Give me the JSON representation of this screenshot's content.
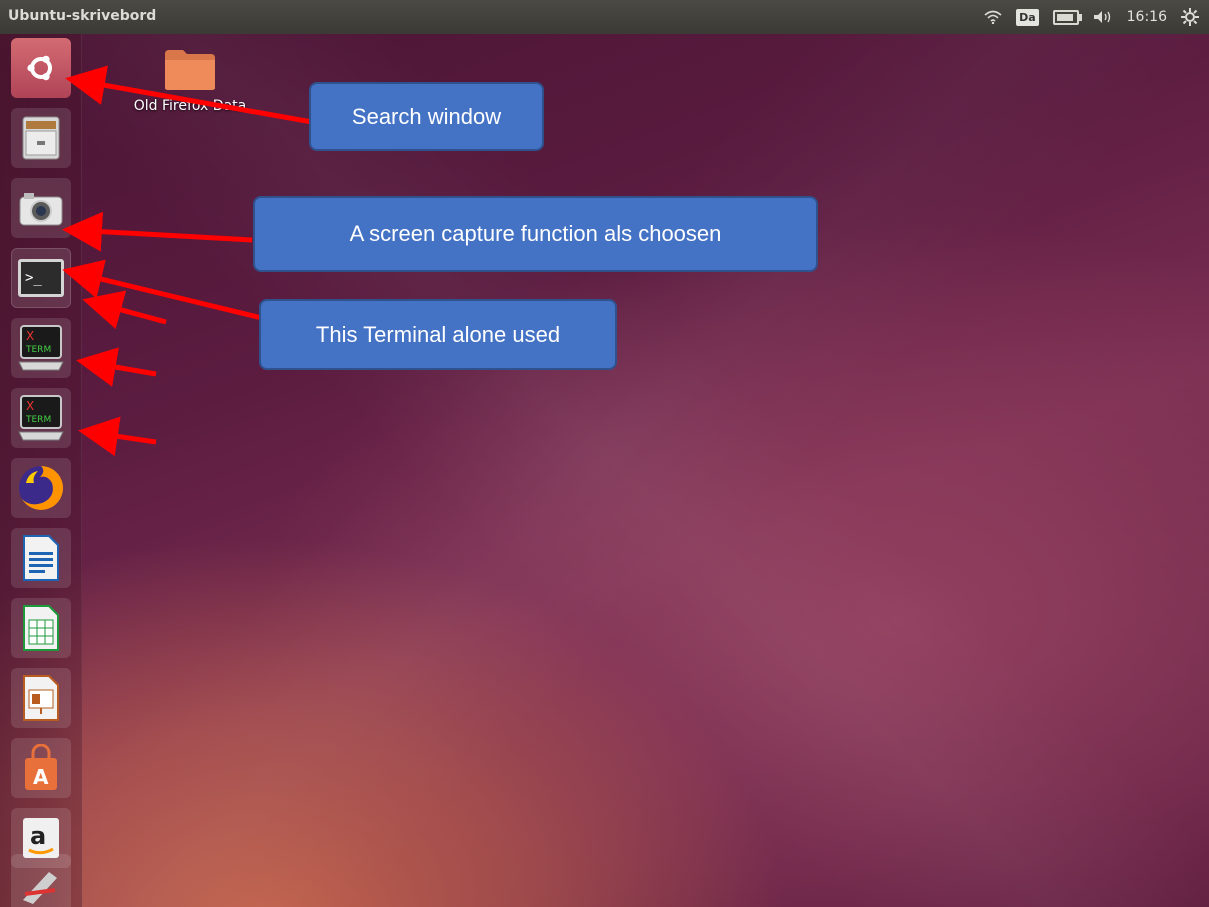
{
  "topbar": {
    "title": "Ubuntu-skrivebord",
    "keyboard_layout": "Da",
    "clock": "16:16",
    "icons": [
      "wifi-icon",
      "keyboard-layout-icon",
      "battery-icon",
      "volume-icon",
      "power-settings-icon"
    ]
  },
  "desktop": {
    "icons": [
      {
        "label": "Old Firefox Data",
        "icon": "folder-icon"
      }
    ]
  },
  "launcher": {
    "items": [
      {
        "name": "dash-search",
        "icon": "ubuntu-logo-icon"
      },
      {
        "name": "files",
        "icon": "file-cabinet-icon"
      },
      {
        "name": "screenshot",
        "icon": "camera-icon"
      },
      {
        "name": "terminal",
        "icon": "terminal-icon"
      },
      {
        "name": "xterm",
        "icon": "xterm-icon"
      },
      {
        "name": "xterm",
        "icon": "xterm-icon"
      },
      {
        "name": "firefox",
        "icon": "firefox-icon"
      },
      {
        "name": "libreoffice-writer",
        "icon": "writer-icon"
      },
      {
        "name": "libreoffice-calc",
        "icon": "calc-icon"
      },
      {
        "name": "libreoffice-impress",
        "icon": "impress-icon"
      },
      {
        "name": "software-center",
        "icon": "shopping-bag-icon"
      },
      {
        "name": "amazon",
        "icon": "amazon-icon"
      },
      {
        "name": "system-settings",
        "icon": "settings-icon"
      }
    ]
  },
  "callouts": [
    {
      "text": "Search window"
    },
    {
      "text": "A screen capture function als choosen"
    },
    {
      "text": "This Terminal alone used"
    }
  ],
  "colors": {
    "callout_fill": "#4472c4",
    "callout_border": "#2f528f",
    "arrow": "#ff0000",
    "topbar": "#3c3b37"
  }
}
